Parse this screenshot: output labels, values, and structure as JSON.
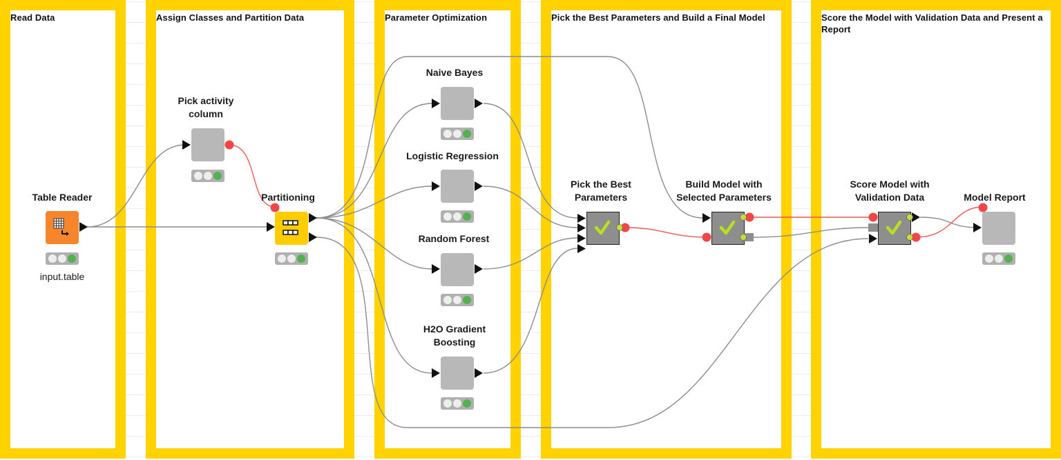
{
  "colors": {
    "annotation_border": "#FFD200",
    "wire_data": "#8c8c8c",
    "wire_flowvar": "#f25555",
    "node_plain": "#b8b8b8",
    "reader_node": "#F7852B",
    "partition_node": "#FFCC00",
    "metanode": "#8e8e8e",
    "status_green": "#55b050",
    "check": "#b8e01e"
  },
  "annotations": [
    {
      "title": "Read Data"
    },
    {
      "title": "Assign Classes and Partition Data"
    },
    {
      "title": "Parameter Optimization"
    },
    {
      "title": "Pick the Best Parameters and Build a Final Model"
    },
    {
      "title": "Score the Model with Validation Data and Present a Report"
    }
  ],
  "nodes": {
    "table_reader": {
      "label": "Table Reader",
      "sublabel": "input.table",
      "icon": "table-reader-icon",
      "status": "executed"
    },
    "pick_activity": {
      "label": "Pick activity column",
      "icon": "component-icon",
      "status": "executed"
    },
    "partitioning": {
      "label": "Partitioning",
      "icon": "partition-icon",
      "status": "executed"
    },
    "naive_bayes": {
      "label": "Naive Bayes",
      "icon": "component-icon",
      "status": "executed"
    },
    "logistic_regression": {
      "label": "Logistic Regression",
      "icon": "component-icon",
      "status": "executed"
    },
    "random_forest": {
      "label": "Random Forest",
      "icon": "component-icon",
      "status": "executed"
    },
    "h2o_gbm": {
      "label": "H2O Gradient Boosting",
      "icon": "component-icon",
      "status": "executed"
    },
    "pick_best": {
      "label": "Pick the Best Parameters",
      "icon": "metanode-check-icon",
      "status": "executed"
    },
    "build_model": {
      "label": "Build Model with Selected Parameters",
      "icon": "metanode-check-icon",
      "status": "executed"
    },
    "score_model": {
      "label": "Score Model with Validation Data",
      "icon": "metanode-check-icon",
      "status": "executed"
    },
    "model_report": {
      "label": "Model Report",
      "icon": "component-icon",
      "status": "executed"
    }
  }
}
